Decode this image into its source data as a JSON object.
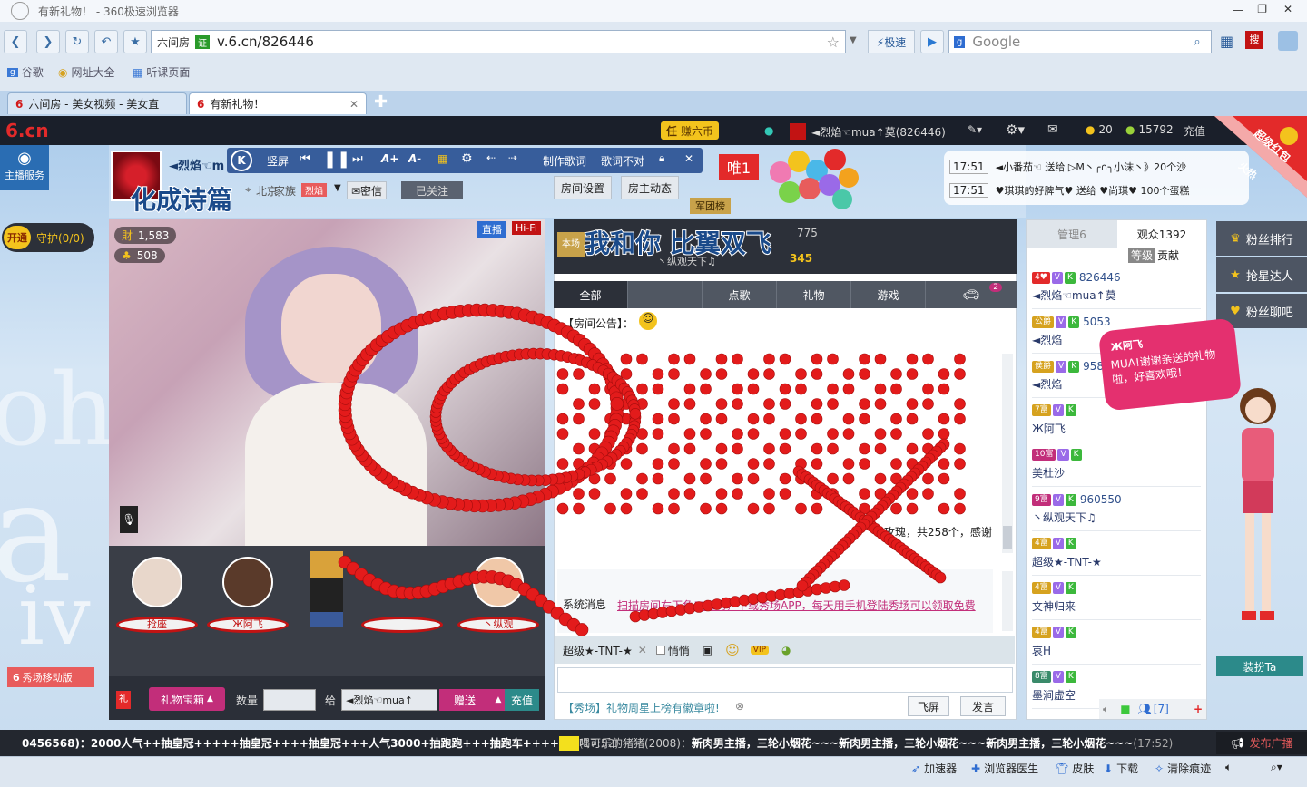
{
  "window": {
    "title": "有新礼物！ - 360极速浏览器"
  },
  "nav": {
    "site_label": "六间房",
    "verified": "证",
    "url": "v.6.cn/826446",
    "accel_label": "⚡极速",
    "search_placeholder": "Google"
  },
  "bookmarks": [
    {
      "label": "谷歌"
    },
    {
      "label": "网址大全"
    },
    {
      "label": "听课页面"
    }
  ],
  "tabs": [
    {
      "label": "六间房 - 美女视频 - 美女直"
    },
    {
      "label": "有新礼物！"
    }
  ],
  "topbar": {
    "logo": "6.cn",
    "earn": "赚六币",
    "user": "◄烈焰☜mua↑莫(826446)",
    "coins": "20",
    "beans": "15792",
    "recharge": "充值"
  },
  "side_left": {
    "host_service": "主播服务",
    "open": "开通",
    "guard": "守护(0/0)",
    "mobile_show": "秀场移动版"
  },
  "streamer": {
    "name": "◄烈焰☜m",
    "location": "北京",
    "family_label": "家族",
    "family_badge": "烈焰",
    "secret_btn": "✉密信",
    "followed_btn": "已关注",
    "room_settings": "房间设置",
    "host_updates": "房主动态",
    "army": "军团榜",
    "wealth": "1,583",
    "fans": "508",
    "live": "直播",
    "hifi": "Hi-Fi",
    "unique": "唯1",
    "lyric_overlay": "化成诗篇"
  },
  "karaoke": {
    "logo": "K",
    "portrait": "竖屏",
    "make_lyrics": "制作歌词",
    "lyrics_wrong": "歌词不对",
    "font_up": "A+",
    "font_down": "A-"
  },
  "seats": [
    {
      "label": "抢座"
    },
    {
      "label": "Ж阿飞"
    },
    {
      "label": ""
    },
    {
      "label": ""
    },
    {
      "label": "丶纵观"
    }
  ],
  "giftbar": {
    "gift_box": "礼物宝箱",
    "quantity": "数量",
    "give_to": "给",
    "recipient": "◄烈焰☜mua↑",
    "send": "赠送",
    "recharge": "充值"
  },
  "chat": {
    "lyric_overlay": "我和你 比翼双飞",
    "audience_count": "775",
    "gift_count": "345",
    "fan_name": "丶纵观天下♫",
    "tabs": [
      {
        "label": "全部"
      },
      {
        "label": ""
      },
      {
        "label": "点歌"
      },
      {
        "label": "礼物"
      },
      {
        "label": "游戏"
      },
      {
        "label": "2"
      }
    ],
    "announcement": "【房间公告】：",
    "gift_msg": "玫瑰，共258个，感谢",
    "system_label": "系统消息",
    "system_msg": "扫描房间右下角二维码，下载秀场APP，每天用手机登陆秀场可以领取免费",
    "to_user": "超级★-TNT-★",
    "whisper": "悄悄",
    "vip": "VIP",
    "promo": "【秀场】礼物周星上榜有徽章啦!",
    "fly_screen": "飞屏",
    "send": "发言"
  },
  "gift_ticker": [
    {
      "time": "17:51",
      "text": "◄小番茄☜ 送给 ▷M丶╭∩╮小沫丶》20个沙"
    },
    {
      "time": "17:51",
      "text": "♥琪琪的好脾气♥ 送给 ♥尚琪♥ 100个蛋糕"
    }
  ],
  "rank": {
    "admin_tab": "管理6",
    "audience_tab": "观众1392",
    "level_label": "等级",
    "contrib_label": "贡献",
    "rows": [
      {
        "badge": "4♥",
        "id": "826446",
        "name": "◄烈焰☜mua↑莫"
      },
      {
        "badge": "公爵",
        "id": "5053",
        "name": "◄烈焰"
      },
      {
        "badge": "侯爵",
        "id": "958",
        "name": "◄烈焰"
      },
      {
        "badge": "7富",
        "id": "",
        "name": "Ж阿飞"
      },
      {
        "badge": "10富",
        "id": "",
        "name": "美杜沙"
      },
      {
        "badge": "9富",
        "id": "960550",
        "name": "丶纵观天下♫"
      },
      {
        "badge": "4富",
        "id": "",
        "name": "超级★-TNT-★"
      },
      {
        "badge": "4富",
        "id": "",
        "name": "文神归来"
      },
      {
        "badge": "4富",
        "id": "",
        "name": "哀H"
      },
      {
        "badge": "8富",
        "id": "",
        "name": "墨涧虚空"
      }
    ],
    "footer_count": "[7]"
  },
  "side_right": {
    "fan_rank": "粉丝排行",
    "star_rank": "抢星达人",
    "fan_chat": "粉丝聊吧",
    "dress_up": "装扮Ta",
    "bubble_name": "Ж阿飞",
    "bubble_text": "MUA!谢谢亲送的礼物啦，好喜欢哦！",
    "corner_badge": "超级红包",
    "hot": "火热"
  },
  "ticker": {
    "left": "0456568)：2000人气++抽皇冠+++++抽皇冠++++抽皇冠+++人气3000+抽跑跑+++抽跑车++++",
    "left_time": "(17:52)",
    "right_user": "喝可乐的猪猪(2008)：",
    "right": "新肉男主播，三轮小烟花~~~新肉男主播，三轮小烟花~~~新肉男主播，三轮小烟花~~~",
    "right_time": "(17:52)",
    "broadcast": "发布广播"
  },
  "status": [
    {
      "label": "加速器"
    },
    {
      "label": "浏览器医生"
    },
    {
      "label": "皮肤"
    },
    {
      "label": "下载"
    },
    {
      "label": "清除痕迹"
    }
  ]
}
